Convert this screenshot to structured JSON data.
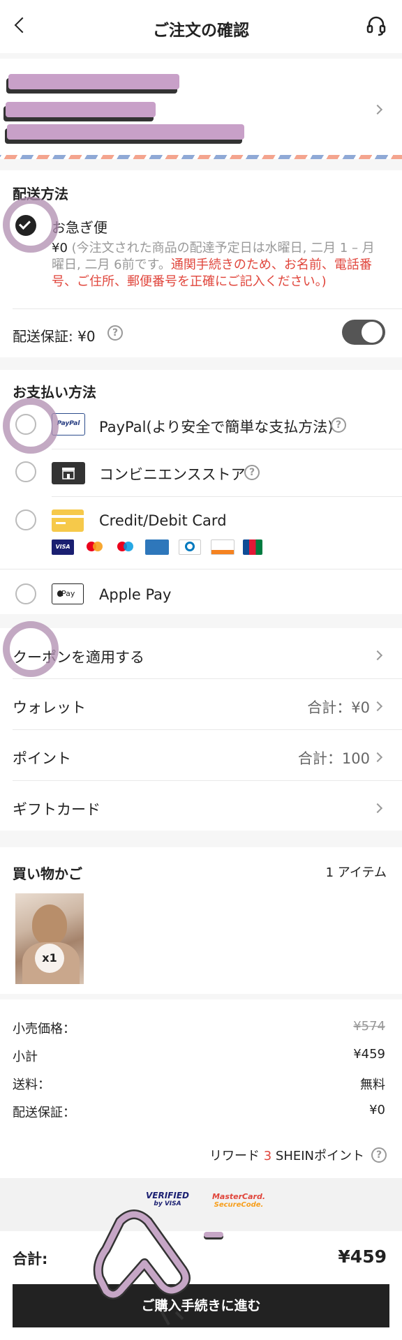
{
  "header": {
    "title": "ご注文の確認"
  },
  "shipping": {
    "heading": "配送方法",
    "option_label": "お急ぎ便",
    "desc_price": "¥0",
    "desc_grey": " (今注文された商品の配達予定日は水曜日, 二月 1 – 月曜日, 二月 6前です。",
    "desc_red": "通関手続きのため、お名前、電話番号、ご住所、郵便番号を正確にご記入ください。)",
    "guarantee_label": "配送保証: ¥0"
  },
  "payment": {
    "heading": "お支払い方法",
    "paypal_label": "PayPal(より安全で簡単な支払方法)",
    "paypal_logo": "PayPal",
    "conbini_label": "コンビニエンスストア",
    "card_label": "Credit/Debit Card",
    "card_brands": [
      "VISA",
      "mastercard",
      "maestro",
      "AMERICAN EXPRESS",
      "Diners Club",
      "DISCOVER",
      "JCB"
    ],
    "applepay_label": "Apple Pay",
    "applepay_logo": " Pay"
  },
  "extras": {
    "coupon_label": "クーポンを適用する",
    "wallet_label": "ウォレット",
    "wallet_value": "合計：¥0",
    "points_label": "ポイント",
    "points_value": "合計：100",
    "giftcard_label": "ギフトカード"
  },
  "cart": {
    "heading": "買い物かご",
    "count": "1 アイテム",
    "qty_badge": "x1"
  },
  "summary": {
    "retail_label": "小売価格：",
    "retail_value": "¥574",
    "subtotal_label": "小計",
    "subtotal_value": "¥459",
    "shipping_label": "送料：",
    "shipping_value": "無料",
    "guarantee_label": "配送保証：",
    "guarantee_value": "¥0",
    "reward_prefix": "リワード",
    "reward_points": "3",
    "reward_suffix": "SHEINポイント"
  },
  "security": {
    "verified_line1": "VERIFIED",
    "verified_line2": "by VISA",
    "mc_line1": "MasterCard.",
    "mc_line2": "SecureCode."
  },
  "footer": {
    "total_label": "合計:",
    "total_value": "¥459",
    "checkout_label": "ご購入手続きに進む"
  },
  "colors": {
    "accent_red": "#e0463c",
    "dark": "#222222",
    "toggle": "#555555",
    "annotation": "#af8caf"
  },
  "icons": [
    "back-arrow-icon",
    "headset-icon",
    "chevron-right-icon",
    "help-icon",
    "checkmark-icon",
    "store-icon",
    "credit-card-icon",
    "apple-icon"
  ]
}
